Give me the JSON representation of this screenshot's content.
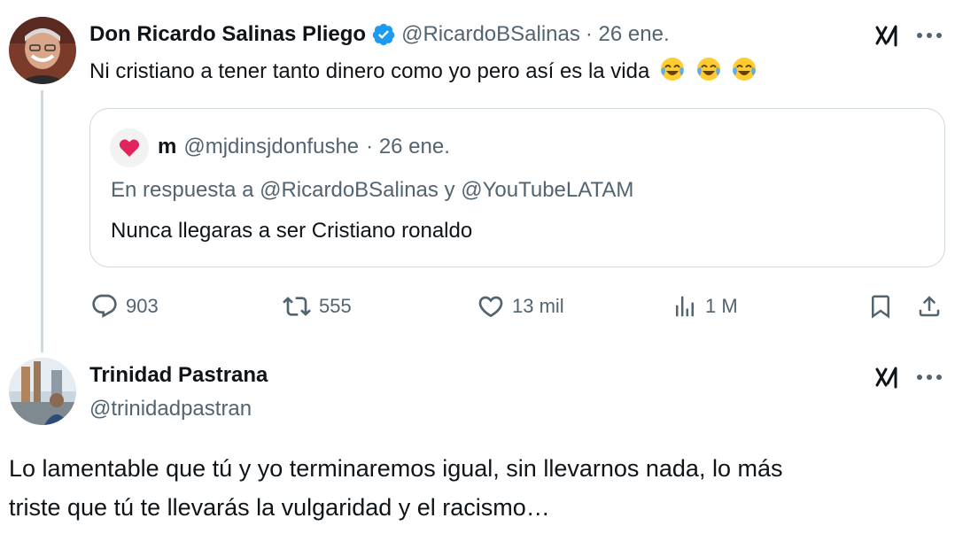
{
  "tweet1": {
    "author_name": "Don Ricardo Salinas Pliego",
    "handle": "@RicardoBSalinas",
    "date": "· 26 ene.",
    "text": "Ni cristiano a tener tanto dinero como yo pero así es la vida",
    "emoji_icon": "joy-emoji",
    "quote": {
      "author_name": "m",
      "handle": "@mjdinsjdonfushe",
      "date": "· 26 ene.",
      "reply_to": "En respuesta a @RicardoBSalinas y @YouTubeLATAM",
      "text": "Nunca llegaras a ser Cristiano ronaldo"
    },
    "stats": {
      "replies": "903",
      "retweets": "555",
      "likes": "13 mil",
      "views": "1 M"
    }
  },
  "tweet2": {
    "author_name": "Trinidad Pastrana",
    "handle": "@trinidadpastran",
    "text_line1": "Lo lamentable que tú y yo terminaremos igual, sin llevarnos nada, lo más",
    "text_line2": "triste que tú te llevarás la vulgaridad y el racismo…"
  },
  "colors": {
    "text_primary": "#0f1419",
    "text_secondary": "#536471",
    "verified_blue": "#1d9bf0",
    "border": "#cfd9de",
    "heart_red": "#e0245e"
  }
}
